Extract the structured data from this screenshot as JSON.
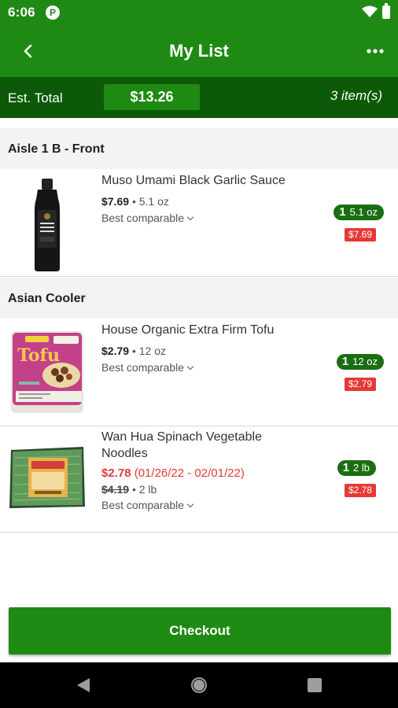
{
  "status_bar": {
    "time": "6:06",
    "app_indicator": "P"
  },
  "app_bar": {
    "title": "My List",
    "back_icon": "arrow-left-icon",
    "more_icon": "more-horizontal-icon"
  },
  "summary": {
    "label": "Est. Total",
    "total": "$13.26",
    "item_count": "3 item(s)"
  },
  "sections": [
    {
      "title": "Aisle 1 B - Front",
      "items": [
        {
          "name": "Muso Umami Black Garlic Sauce",
          "price": "$7.69",
          "size": "• 5.1 oz",
          "best_label": "Best comparable",
          "qty": "1",
          "qty_unit": "5.1 oz",
          "line_total": "$7.69"
        }
      ]
    },
    {
      "title": "Asian Cooler",
      "items": [
        {
          "name": "House Organic Extra Firm Tofu",
          "price": "$2.79",
          "size": "• 12 oz",
          "best_label": "Best comparable",
          "qty": "1",
          "qty_unit": "12 oz",
          "line_total": "$2.79",
          "image_text": "Tofu"
        },
        {
          "name": "Wan Hua Spinach Vegetable Noodles",
          "sale_price": "$2.78",
          "sale_dates": "(01/26/22 - 02/01/22)",
          "original_price": "$4.19",
          "size": "• 2 lb",
          "best_label": "Best comparable",
          "qty": "1",
          "qty_unit": "2 lb",
          "line_total": "$2.78"
        }
      ]
    }
  ],
  "checkout_label": "Checkout",
  "nav": {
    "back_icon": "nav-back-icon",
    "home_icon": "nav-home-icon",
    "recents_icon": "nav-recents-icon"
  },
  "colors": {
    "primary": "#1f8a13",
    "dark": "#0c5a07",
    "badge_green": "#1a6e12",
    "sale_red": "#e53935"
  }
}
